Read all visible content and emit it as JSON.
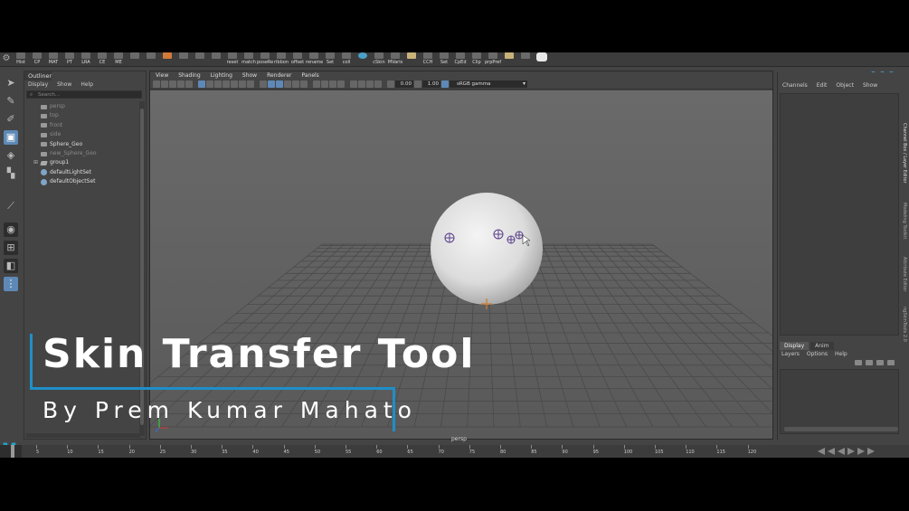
{
  "shelf": {
    "buttons": [
      {
        "label": "Hist",
        "icon": "history-icon",
        "style": ""
      },
      {
        "label": "CP",
        "icon": "cp-icon",
        "style": ""
      },
      {
        "label": "MAT",
        "icon": "material-icon",
        "style": ""
      },
      {
        "label": "PT",
        "icon": "pt-icon",
        "style": ""
      },
      {
        "label": "LRA",
        "icon": "lra-icon",
        "style": ""
      },
      {
        "label": "CE",
        "icon": "ce-icon",
        "style": ""
      },
      {
        "label": "ME",
        "icon": "me-icon",
        "style": ""
      },
      {
        "label": "",
        "icon": "star-icon",
        "style": ""
      },
      {
        "label": "",
        "icon": "circle-icon",
        "style": ""
      },
      {
        "label": "",
        "icon": "diamond-icon",
        "style": "ora"
      },
      {
        "label": "",
        "icon": "bones-icon",
        "style": ""
      },
      {
        "label": "",
        "icon": "ik-icon",
        "style": ""
      },
      {
        "label": "",
        "icon": "pin-icon",
        "style": ""
      },
      {
        "label": "reset",
        "icon": "reset-icon",
        "style": ""
      },
      {
        "label": "match",
        "icon": "match-icon",
        "style": ""
      },
      {
        "label": "poseRe",
        "icon": "pose-icon",
        "style": ""
      },
      {
        "label": "ribbon",
        "icon": "ribbon-icon",
        "style": ""
      },
      {
        "label": "offset",
        "icon": "offset-icon",
        "style": ""
      },
      {
        "label": "rename",
        "icon": "rename-icon",
        "style": ""
      },
      {
        "label": "Set",
        "icon": "set-icon",
        "style": ""
      },
      {
        "label": "coll",
        "icon": "coll-icon",
        "style": ""
      },
      {
        "label": "",
        "icon": "sphere-icon",
        "style": "blue"
      },
      {
        "label": "cSkin",
        "icon": "cskin-icon",
        "style": ""
      },
      {
        "label": "MVaris",
        "icon": "mvaris-icon",
        "style": ""
      },
      {
        "label": "",
        "icon": "paint-icon",
        "style": "hl"
      },
      {
        "label": "CCH",
        "icon": "cch-icon",
        "style": ""
      },
      {
        "label": "Set",
        "icon": "set2-icon",
        "style": ""
      },
      {
        "label": "CpEd",
        "icon": "cped-icon",
        "style": ""
      },
      {
        "label": "Clip",
        "icon": "clip-icon",
        "style": ""
      },
      {
        "label": "prpPref",
        "icon": "prpref-icon",
        "style": ""
      },
      {
        "label": "",
        "icon": "yellow-tool-icon",
        "style": "hl"
      },
      {
        "label": "",
        "icon": "tool-icon",
        "style": ""
      },
      {
        "label": "",
        "icon": "white-box-icon",
        "style": "white"
      }
    ]
  },
  "outliner": {
    "title": "Outliner",
    "menu": [
      "Display",
      "Show",
      "Help"
    ],
    "search_placeholder": "Search...",
    "items": [
      {
        "label": "persp",
        "type": "camera",
        "dim": true
      },
      {
        "label": "top",
        "type": "camera",
        "dim": true
      },
      {
        "label": "front",
        "type": "camera",
        "dim": true
      },
      {
        "label": "side",
        "type": "camera",
        "dim": true
      },
      {
        "label": "Sphere_Geo",
        "type": "mesh",
        "dim": false
      },
      {
        "label": "new_Sphere_Geo",
        "type": "mesh",
        "dim": true
      },
      {
        "label": "group1",
        "type": "group",
        "dim": false,
        "expandable": true
      },
      {
        "label": "defaultLightSet",
        "type": "set",
        "dim": false
      },
      {
        "label": "defaultObjectSet",
        "type": "set",
        "dim": false
      }
    ]
  },
  "viewport": {
    "menu": [
      "View",
      "Shading",
      "Lighting",
      "Show",
      "Renderer",
      "Panels"
    ],
    "exposure": "0.00",
    "gamma": "1.00",
    "color_space": "sRGB gamma",
    "camera_label": "persp"
  },
  "channel_box": {
    "menu": [
      "Channels",
      "Edit",
      "Object",
      "Show"
    ],
    "layer_tabs": [
      "Display",
      "Anim"
    ],
    "layer_menu": [
      "Layers",
      "Options",
      "Help"
    ],
    "side_tabs": [
      "Channel Box / Layer Editor",
      "Modeling Toolkit",
      "Attribute Editor",
      "ngSkinTools 2.0"
    ]
  },
  "timeline": {
    "ticks": [
      "5",
      "10",
      "15",
      "20",
      "25",
      "30",
      "35",
      "40",
      "45",
      "50",
      "55",
      "60",
      "65",
      "70",
      "75",
      "80",
      "85",
      "90",
      "95",
      "100",
      "105",
      "110",
      "115",
      "120"
    ]
  },
  "overlay": {
    "title": "Skin Transfer Tool",
    "subtitle": "By Prem Kumar Mahato"
  },
  "colors": {
    "accent": "#1e8fc8",
    "viewport_bg": "#5f5f5f",
    "active_tool": "#5e89b6",
    "maya_logo": "#1fa3c9"
  }
}
